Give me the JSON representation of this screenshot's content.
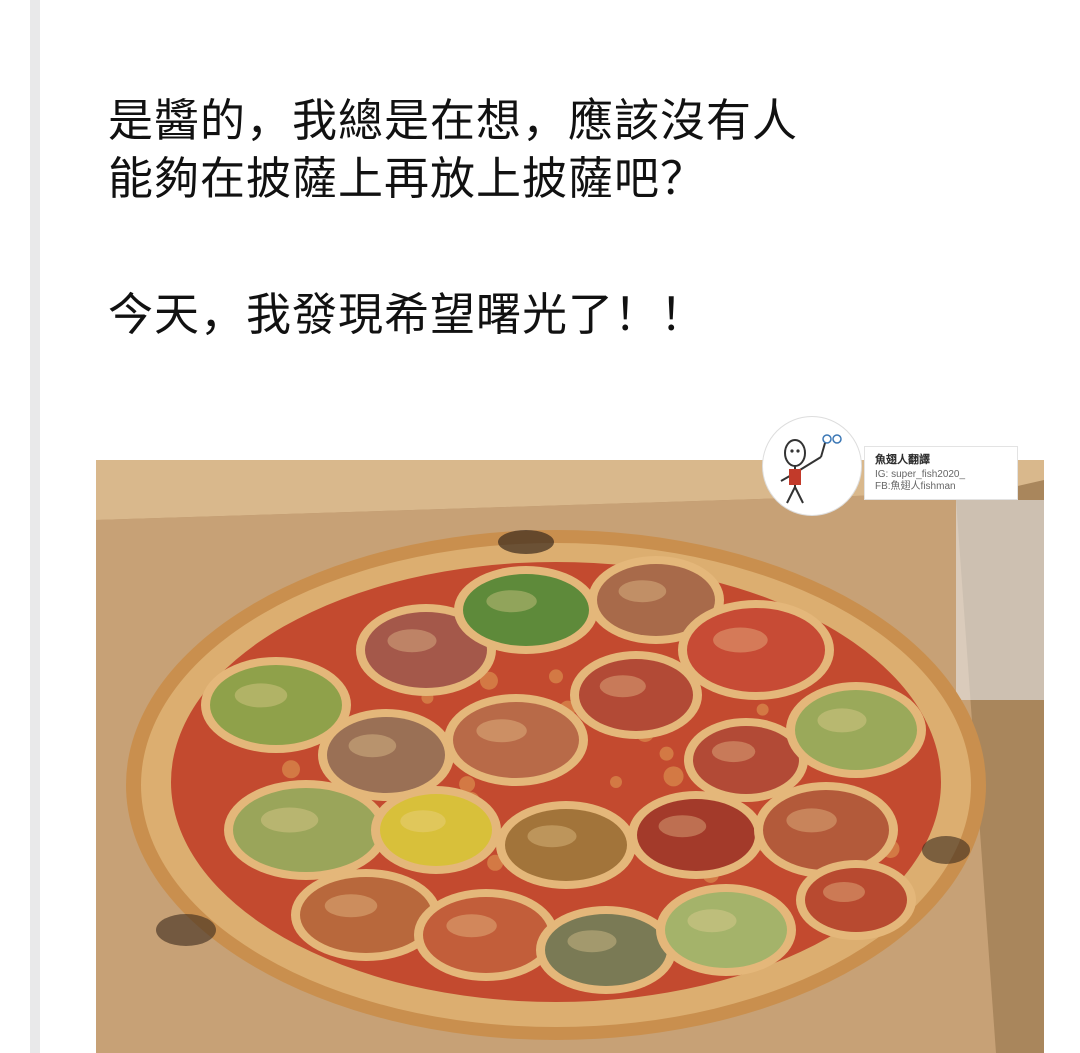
{
  "post": {
    "caption_lines": [
      "是醬的，我總是在想，應該沒有人",
      "能夠在披薩上再放上披薩吧？",
      "今天，我發現希望曙光了！！"
    ]
  },
  "watermark": {
    "name": "魚翅人翻譯",
    "ig": "IG: super_fish2020_",
    "fb": "FB:魚翅人fishman"
  },
  "photo": {
    "subject": "large pizza topped with many mini pizzas in a cardboard box",
    "colors": {
      "box": "#c9a57c",
      "crust": "#d8a866",
      "sauce": "#c5442b",
      "cheese": "#e8c27e"
    }
  }
}
